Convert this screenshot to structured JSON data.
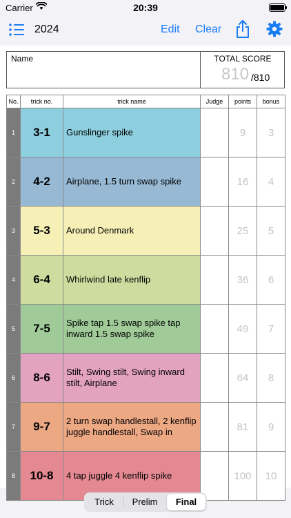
{
  "status_bar": {
    "carrier": "Carrier",
    "time": "20:39"
  },
  "nav": {
    "year": "2024",
    "edit_label": "Edit",
    "clear_label": "Clear"
  },
  "score": {
    "name_label": "Name",
    "total_label": "TOTAL SCORE",
    "total_value": "810",
    "total_max": "/810"
  },
  "table": {
    "headers": {
      "no": "No.",
      "trick_no": "trick no.",
      "trick_name": "trick name",
      "judge": "Judge",
      "points": "points",
      "bonus": "bonus"
    },
    "rows": [
      {
        "no": "1",
        "trick_no": "3-1",
        "name": "Gunslinger spike",
        "points": "9",
        "bonus": "3",
        "color": "#8ecfdf"
      },
      {
        "no": "2",
        "trick_no": "4-2",
        "name": "Airplane, 1.5 turn swap spike",
        "points": "16",
        "bonus": "4",
        "color": "#97b9d4"
      },
      {
        "no": "3",
        "trick_no": "5-3",
        "name": "Around Denmark",
        "points": "25",
        "bonus": "5",
        "color": "#f6f0b7"
      },
      {
        "no": "4",
        "trick_no": "6-4",
        "name": "Whirlwind late kenflip",
        "points": "36",
        "bonus": "6",
        "color": "#cfdc9f"
      },
      {
        "no": "5",
        "trick_no": "7-5",
        "name": "Spike tap 1.5 swap spike tap inward 1.5 swap spike",
        "points": "49",
        "bonus": "7",
        "color": "#a0cb98"
      },
      {
        "no": "6",
        "trick_no": "8-6",
        "name": "Stilt, Swing stilt, Swing inward stilt, Airplane",
        "points": "64",
        "bonus": "8",
        "color": "#e2a2c0"
      },
      {
        "no": "7",
        "trick_no": "9-7",
        "name": "2 turn swap handlestall, 2 kenflip juggle handlestall, Swap in",
        "points": "81",
        "bonus": "9",
        "color": "#eca783"
      },
      {
        "no": "8",
        "trick_no": "10-8",
        "name": "4 tap juggle 4 kenflip spike",
        "points": "100",
        "bonus": "10",
        "color": "#e48992"
      }
    ]
  },
  "segmented": {
    "options": [
      "Trick",
      "Prelim",
      "Final"
    ],
    "selected": "Final"
  },
  "colors": {
    "accent": "#1a7cf2",
    "no_column": "#7b7b7b",
    "score_placeholder": "#c4c4c4"
  },
  "icons": {
    "menu": "list-icon",
    "share": "share-icon",
    "settings": "gear-icon",
    "wifi": "wifi-icon",
    "battery": "battery-icon"
  }
}
